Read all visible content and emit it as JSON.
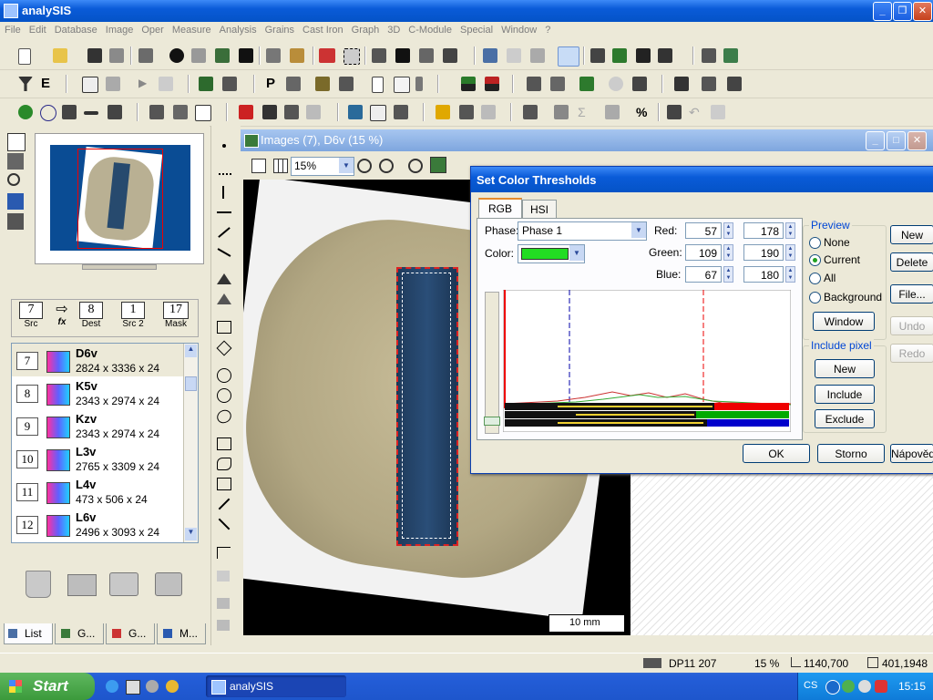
{
  "app": {
    "title": "analySIS"
  },
  "menu": [
    "File",
    "Edit",
    "Database",
    "Image",
    "Oper",
    "Measure",
    "Analysis",
    "Grains",
    "Cast Iron",
    "Graph",
    "3D",
    "C-Module",
    "Special",
    "Window",
    "?"
  ],
  "buffers": [
    {
      "num": "7",
      "label": "Src"
    },
    {
      "num": "8",
      "label": "Dest"
    },
    {
      "num": "1",
      "label": "Src 2"
    },
    {
      "num": "17",
      "label": "Mask"
    }
  ],
  "fx_label": "fx",
  "images": [
    {
      "num": "7",
      "name": "D6v",
      "size": "2824 x 3336 x 24"
    },
    {
      "num": "8",
      "name": "K5v",
      "size": "2343 x 2974 x 24"
    },
    {
      "num": "9",
      "name": "Kzv",
      "size": "2343 x 2974 x 24"
    },
    {
      "num": "10",
      "name": "L3v",
      "size": "2765 x 3309 x 24"
    },
    {
      "num": "11",
      "name": "L4v",
      "size": "473 x 506 x 24"
    },
    {
      "num": "12",
      "name": "L6v",
      "size": "2496 x 3093 x 24"
    }
  ],
  "bottom_tabs": [
    "List",
    "G...",
    "G...",
    "M..."
  ],
  "image_window": {
    "title": "Images (7), D6v (15 %)",
    "zoom": "15%",
    "scalebar": "10 mm"
  },
  "dialog": {
    "title": "Set Color Thresholds",
    "tabs": [
      "RGB",
      "HSI"
    ],
    "phase_label": "Phase:",
    "phase_value": "Phase 1",
    "color_label": "Color:",
    "color_value": "#22dd22",
    "red_label": "Red:",
    "red_min": "57",
    "red_max": "178",
    "green_label": "Green:",
    "green_min": "109",
    "green_max": "190",
    "blue_label": "Blue:",
    "blue_min": "67",
    "blue_max": "180",
    "preview_title": "Preview",
    "preview_options": [
      "None",
      "Current",
      "All",
      "Background"
    ],
    "preview_selected": "Current",
    "window_button": "Window",
    "include_title": "Include pixel",
    "include_buttons": [
      "New",
      "Include",
      "Exclude"
    ],
    "side_buttons": [
      "New",
      "Delete",
      "File...",
      "Undo",
      "Redo"
    ],
    "ok": "OK",
    "storno": "Storno",
    "help": "Nápověda"
  },
  "status": {
    "camera": "DP11 207",
    "zoom": "15 %",
    "position": "1140,700",
    "size": "401,1948"
  },
  "taskbar": {
    "start": "Start",
    "task": "analySIS",
    "lang": "CS",
    "clock": "15:15"
  }
}
